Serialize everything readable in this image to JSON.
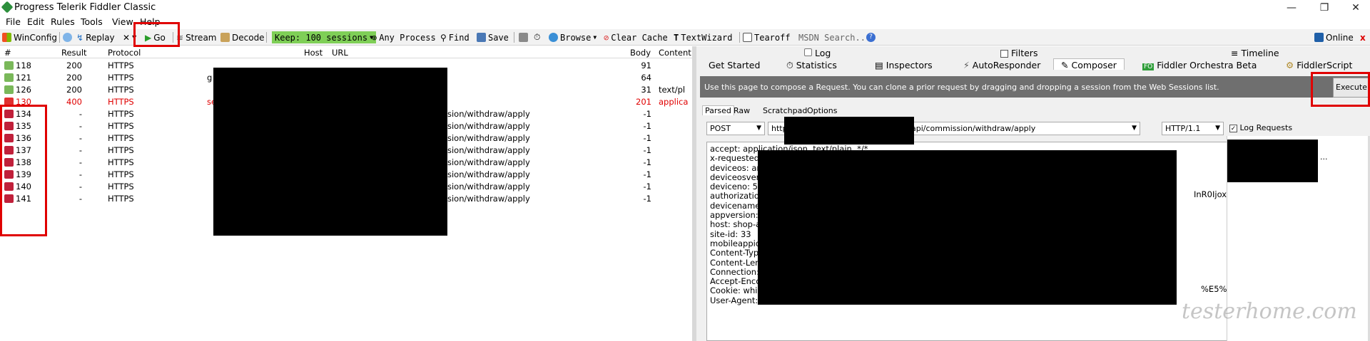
{
  "window": {
    "title": "Progress Telerik Fiddler Classic"
  },
  "menu": [
    "File",
    "Edit",
    "Rules",
    "Tools",
    "View",
    "Help"
  ],
  "toolbar": {
    "winconfig": "WinConfig",
    "replay": "Replay",
    "remove": "✕",
    "go": "Go",
    "stream": "Stream",
    "decode": "Decode",
    "keep": "Keep: 100 sessions",
    "any_process": "Any Process",
    "find": "Find",
    "save": "Save",
    "browse": "Browse",
    "clear_cache": "Clear Cache",
    "text_wizard": "TextWizard",
    "tearoff": "Tearoff",
    "msdn_search": "MSDN Search...",
    "online": "Online"
  },
  "sessions": {
    "columns": [
      "#",
      "Result",
      "Protocol",
      "Host",
      "URL",
      "Body",
      "Content"
    ],
    "rows": [
      {
        "id": "118",
        "result": "200",
        "protocol": "HTTPS",
        "host": "",
        "url": "",
        "body": "91",
        "content": "",
        "status": "ok"
      },
      {
        "id": "121",
        "result": "200",
        "protocol": "HTTPS",
        "host": "g",
        "url": "",
        "body": "64",
        "content": "",
        "status": "ok"
      },
      {
        "id": "126",
        "result": "200",
        "protocol": "HTTPS",
        "host": "",
        "url": "",
        "body": "31",
        "content": "text/pl",
        "status": "ok"
      },
      {
        "id": "130",
        "result": "400",
        "protocol": "HTTPS",
        "host": "se",
        "url": "",
        "body": "201",
        "content": "applica",
        "status": "error"
      },
      {
        "id": "134",
        "result": "-",
        "protocol": "HTTPS",
        "host": "",
        "url": "sion/withdraw/apply",
        "body": "-1",
        "content": "",
        "status": "pending"
      },
      {
        "id": "135",
        "result": "-",
        "protocol": "HTTPS",
        "host": "",
        "url": "sion/withdraw/apply",
        "body": "-1",
        "content": "",
        "status": "pending"
      },
      {
        "id": "136",
        "result": "-",
        "protocol": "HTTPS",
        "host": "",
        "url": "sion/withdraw/apply",
        "body": "-1",
        "content": "",
        "status": "pending"
      },
      {
        "id": "137",
        "result": "-",
        "protocol": "HTTPS",
        "host": "",
        "url": "sion/withdraw/apply",
        "body": "-1",
        "content": "",
        "status": "pending"
      },
      {
        "id": "138",
        "result": "-",
        "protocol": "HTTPS",
        "host": "",
        "url": "sion/withdraw/apply",
        "body": "-1",
        "content": "",
        "status": "pending"
      },
      {
        "id": "139",
        "result": "-",
        "protocol": "HTTPS",
        "host": "",
        "url": "sion/withdraw/apply",
        "body": "-1",
        "content": "",
        "status": "pending"
      },
      {
        "id": "140",
        "result": "-",
        "protocol": "HTTPS",
        "host": "",
        "url": "sion/withdraw/apply",
        "body": "-1",
        "content": "",
        "status": "pending"
      },
      {
        "id": "141",
        "result": "-",
        "protocol": "HTTPS",
        "host": "",
        "url": "sion/withdraw/apply",
        "body": "-1",
        "content": "",
        "status": "pending"
      }
    ]
  },
  "right_tabs": {
    "row1": {
      "log": "Log",
      "filters": "Filters",
      "timeline": "Timeline"
    },
    "row2": {
      "get_started": "Get Started",
      "statistics": "Statistics",
      "inspectors": "Inspectors",
      "autoresponder": "AutoResponder",
      "composer": "Composer",
      "orchestra": "Fiddler Orchestra Beta",
      "fiddlerscript": "FiddlerScript",
      "fo_badge": "FO"
    }
  },
  "composer": {
    "info": "Use this page to compose a Request. You can clone a prior request by dragging and dropping a session from the Web Sessions list.",
    "execute": "Execute",
    "subtabs": [
      "Parsed",
      "Raw",
      "Scratchpad",
      "Options"
    ],
    "method": "POST",
    "url_prefix": "http",
    "url_suffix": "api/commission/withdraw/apply",
    "http_version": "HTTP/1.1",
    "log_requests": "Log Requests",
    "headers": [
      "accept: application/json, text/plain, */*",
      "x-requested-",
      "deviceos: an",
      "deviceosvers",
      "deviceno: 58",
      "authorization",
      "devicename:",
      "appversion: 1",
      "host: shop-a",
      "site-id: 33",
      "mobileappid:",
      "Content-Typ",
      "Content-Len",
      "Connection:",
      "Accept-Enco",
      "Cookie: whist",
      "User-Agent:"
    ],
    "header_tail_auth": "InR0IjoxN",
    "header_tail_cookie": "%E5%A",
    "history_more": "..."
  },
  "watermark": "testerhome.com",
  "colors": {
    "keep_green": "#7fcf57",
    "error_red": "#e00000",
    "highlight_red": "#e00000",
    "info_bar": "#6f6f6f"
  }
}
